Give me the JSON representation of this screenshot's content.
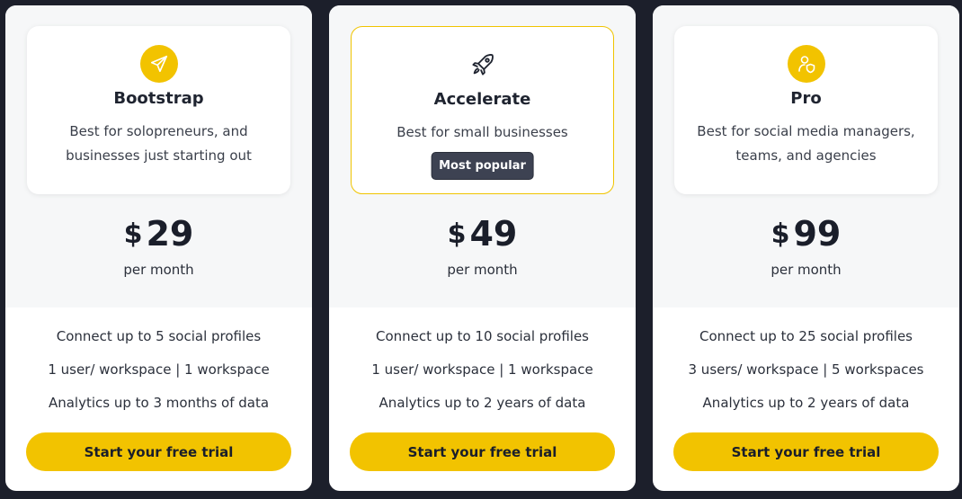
{
  "plans": [
    {
      "icon": "paper-plane-icon",
      "name": "Bootstrap",
      "description": "Best for solopreneurs, and businesses just starting out",
      "badge": "",
      "currency": "$",
      "price": "29",
      "period": "per month",
      "features": [
        "Connect up to 5 social profiles",
        "1 user/ workspace | 1 workspace",
        "Analytics up to 3 months of data"
      ],
      "cta": "Start your free trial"
    },
    {
      "icon": "rocket-icon",
      "name": "Accelerate",
      "description": "Best for small businesses",
      "badge": "Most popular",
      "currency": "$",
      "price": "49",
      "period": "per month",
      "features": [
        "Connect up to 10 social profiles",
        "1 user/ workspace | 1 workspace",
        "Analytics up to 2 years of data"
      ],
      "cta": "Start your free trial"
    },
    {
      "icon": "user-shield-icon",
      "name": "Pro",
      "description": "Best for social media managers, teams, and agencies",
      "badge": "",
      "currency": "$",
      "price": "99",
      "period": "per month",
      "features": [
        "Connect up to 25 social profiles",
        "3 users/ workspace | 5 workspaces",
        "Analytics up to 2 years of data"
      ],
      "cta": "Start your free trial"
    }
  ],
  "colors": {
    "accent": "#f2c300",
    "page_background": "#1c1f2b",
    "badge_background": "#3d4252"
  }
}
